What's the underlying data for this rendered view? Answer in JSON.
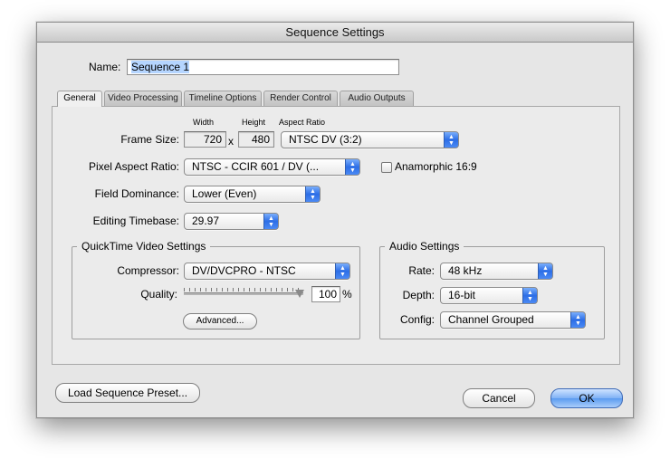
{
  "window": {
    "title": "Sequence Settings"
  },
  "name_field": {
    "label": "Name:",
    "value": "Sequence 1"
  },
  "tabs": [
    {
      "label": "General",
      "active": true
    },
    {
      "label": "Video Processing",
      "active": false
    },
    {
      "label": "Timeline Options",
      "active": false
    },
    {
      "label": "Render Control",
      "active": false
    },
    {
      "label": "Audio Outputs",
      "active": false
    }
  ],
  "general": {
    "frame_size": {
      "label": "Frame Size:",
      "width_header": "Width",
      "height_header": "Height",
      "aspect_header": "Aspect Ratio",
      "width": "720",
      "times": "x",
      "height": "480",
      "aspect_ratio": "NTSC DV (3:2)"
    },
    "pixel_aspect": {
      "label": "Pixel Aspect Ratio:",
      "value": "NTSC - CCIR 601 / DV (..."
    },
    "anamorphic": {
      "label": "Anamorphic 16:9",
      "checked": false
    },
    "field_dominance": {
      "label": "Field Dominance:",
      "value": "Lower (Even)"
    },
    "editing_timebase": {
      "label": "Editing Timebase:",
      "value": "29.97"
    },
    "quicktime": {
      "title": "QuickTime Video Settings",
      "compressor_label": "Compressor:",
      "compressor": "DV/DVCPRO - NTSC",
      "quality_label": "Quality:",
      "quality": "100",
      "quality_unit": "%",
      "advanced_label": "Advanced..."
    },
    "audio": {
      "title": "Audio Settings",
      "rate_label": "Rate:",
      "rate": "48 kHz",
      "depth_label": "Depth:",
      "depth": "16-bit",
      "config_label": "Config:",
      "config": "Channel Grouped"
    }
  },
  "footer": {
    "load_preset": "Load Sequence Preset...",
    "cancel": "Cancel",
    "ok": "OK"
  },
  "colors": {
    "accent": "#4b8af4",
    "selection": "#b5d5ff",
    "window_bg": "#e6e6e6"
  }
}
